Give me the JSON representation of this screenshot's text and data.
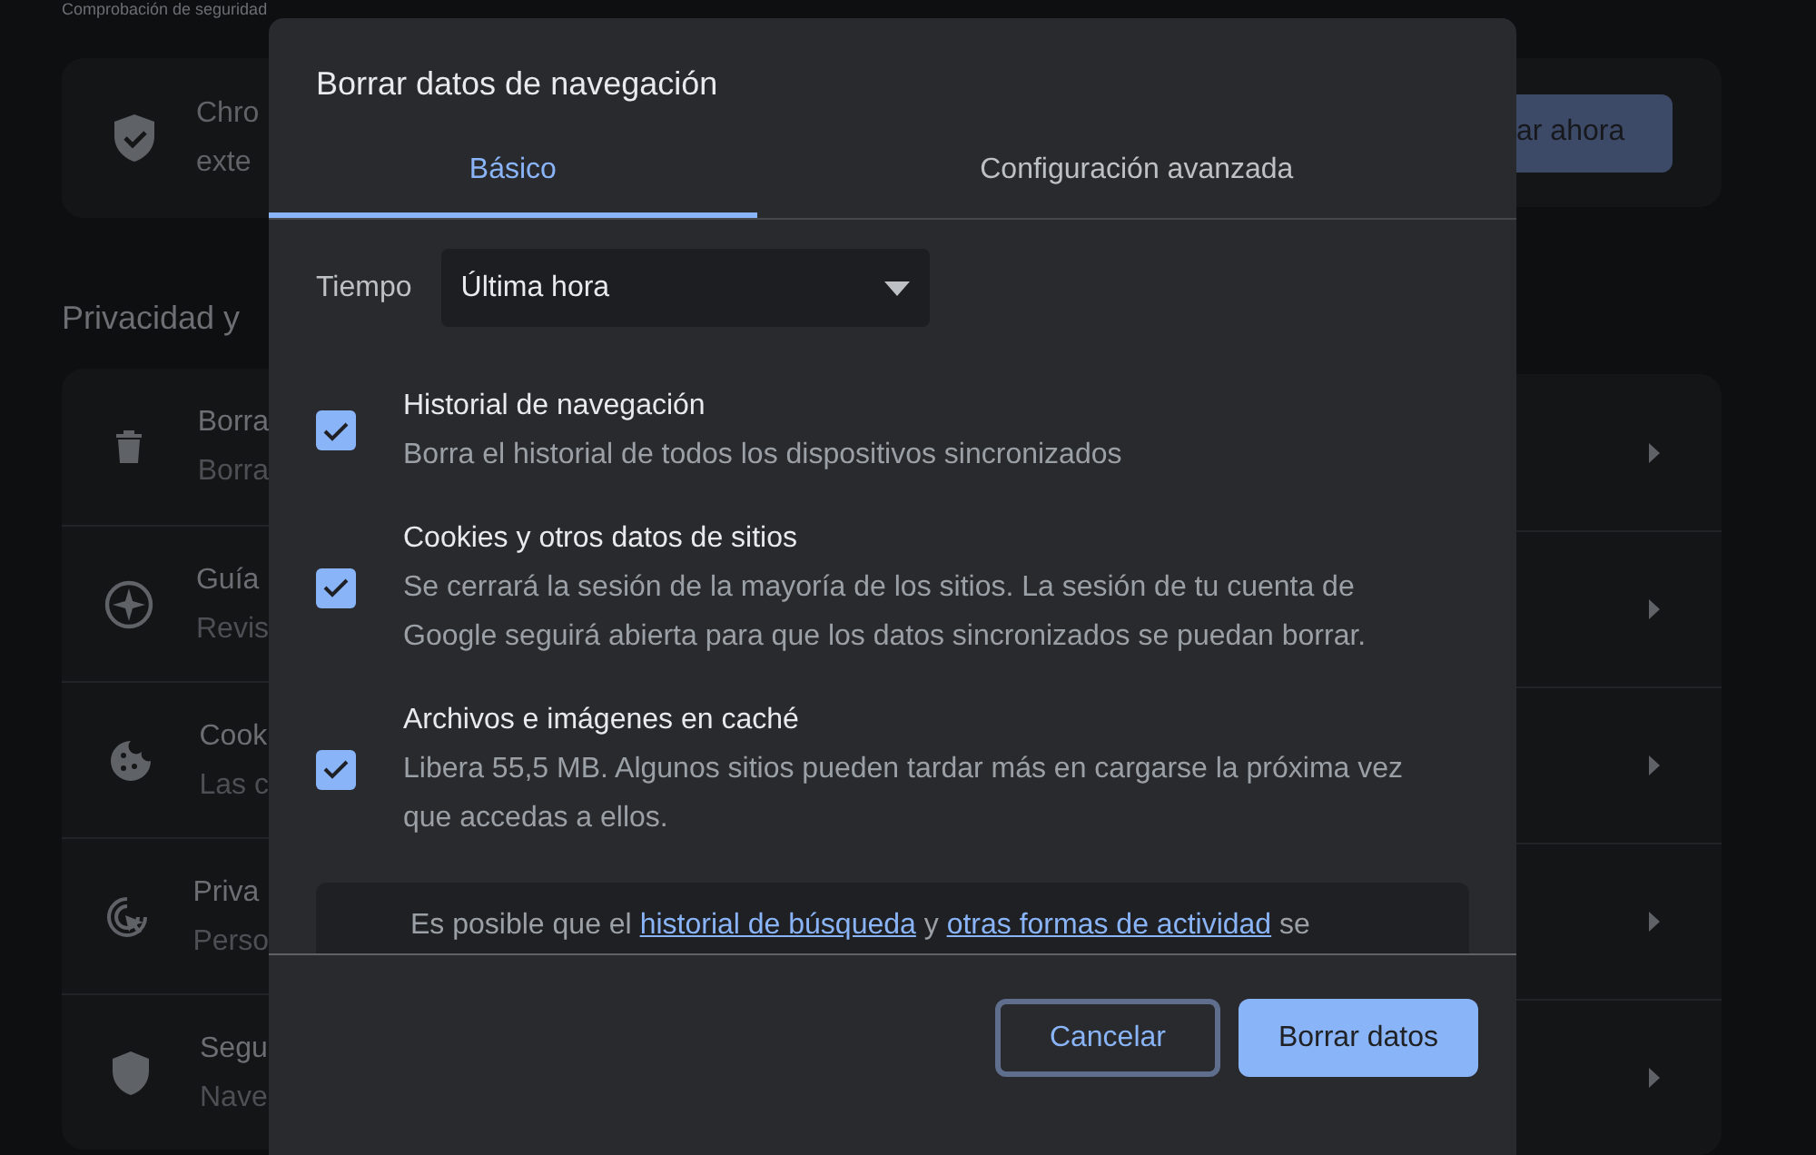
{
  "background": {
    "heading": "Comprobación de seguridad",
    "safety_card": {
      "title": "Chro",
      "subtitle": "exte",
      "button": "ar ahora"
    },
    "section_title": "Privacidad y",
    "rows": [
      {
        "title": "Borra",
        "subtitle": "Borra"
      },
      {
        "title": "Guía",
        "subtitle": "Revis"
      },
      {
        "title": "Cook",
        "subtitle": "Las c"
      },
      {
        "title": "Priva",
        "subtitle": "Perso"
      },
      {
        "title": "Segu",
        "subtitle": "Nave"
      }
    ]
  },
  "dialog": {
    "title": "Borrar datos de navegación",
    "tabs": [
      {
        "label": "Básico",
        "selected": true
      },
      {
        "label": "Configuración avanzada",
        "selected": false
      }
    ],
    "time_range": {
      "label": "Tiempo",
      "value": "Última hora"
    },
    "options": [
      {
        "title": "Historial de navegación",
        "description": "Borra el historial de todos los dispositivos sincronizados",
        "checked": true
      },
      {
        "title": "Cookies y otros datos de sitios",
        "description": "Se cerrará la sesión de la mayoría de los sitios. La sesión de tu cuenta de Google seguirá abierta para que los datos sincronizados se puedan borrar.",
        "checked": true
      },
      {
        "title": "Archivos e imágenes en caché",
        "description": "Libera 55,5 MB. Algunos sitios pueden tardar más en cargarse la próxima vez que accedas a ellos.",
        "checked": true
      }
    ],
    "notice": [
      {
        "kind": "text",
        "text": "Es posible que el "
      },
      {
        "kind": "link",
        "text": "historial de búsqueda"
      },
      {
        "kind": "text",
        "text": " y "
      },
      {
        "kind": "link",
        "text": "otras formas de actividad"
      },
      {
        "kind": "text",
        "text": " se"
      }
    ],
    "buttons": [
      {
        "label": "Cancelar",
        "kind": "secondary"
      },
      {
        "label": "Borrar datos",
        "kind": "primary"
      }
    ]
  }
}
